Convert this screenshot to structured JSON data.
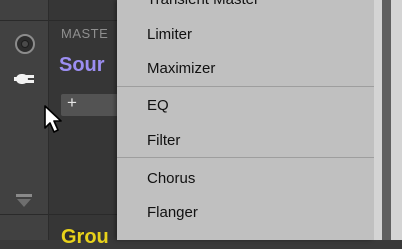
{
  "master_label": "MASTE",
  "sound_name": "Sour",
  "add_button_label": "+",
  "group_label": "Grou",
  "menu": {
    "items": [
      {
        "label": "Transient Master"
      },
      {
        "label": "Limiter"
      },
      {
        "label": "Maximizer"
      },
      {
        "label": "EQ"
      },
      {
        "label": "Filter"
      },
      {
        "label": "Chorus"
      },
      {
        "label": "Flanger"
      }
    ]
  },
  "colors": {
    "sound_name": "#9c8ef2",
    "group_label": "#e8d21a",
    "menu_bg": "#c0c0c0"
  },
  "icons": {
    "knob": "knob-icon",
    "plug": "plug-icon",
    "collapse": "down-arrow-icon",
    "cursor": "cursor-icon"
  }
}
